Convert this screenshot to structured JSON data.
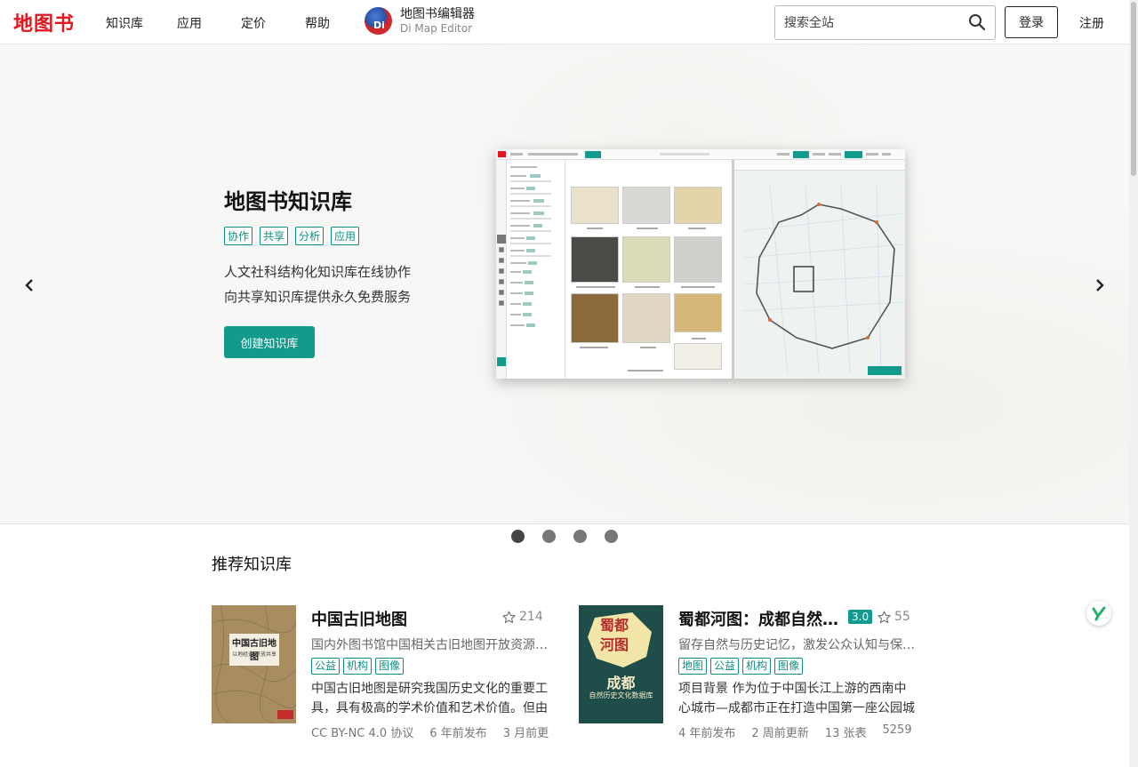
{
  "header": {
    "logo": "地图书",
    "nav": [
      "知识库",
      "应用",
      "定价",
      "帮助"
    ],
    "editor": {
      "badge": "Di",
      "title": "地图书编辑器",
      "subtitle": "Di Map Editor"
    },
    "search_placeholder": "搜索全站",
    "login_label": "登录",
    "register_label": "注册"
  },
  "hero": {
    "title": "地图书知识库",
    "tags": [
      "协作",
      "共享",
      "分析",
      "应用"
    ],
    "desc_line1": "人文社科结构化知识库在线协作",
    "desc_line2": "向共享知识库提供永久免费服务",
    "cta_label": "创建知识库",
    "slide_count": 4,
    "active_slide": 0
  },
  "recommended": {
    "title": "推荐知识库",
    "cards": [
      {
        "cover_title": "中国古旧地图",
        "cover_subtitle": "以地经史 开放共享",
        "title": "中国古旧地图",
        "stars": "214",
        "version": "",
        "subtitle": "国内外图书馆中国相关古旧地图开放资源汇总",
        "tags": [
          "公益",
          "机构",
          "图像"
        ],
        "desc": "中国古旧地图是研究我国历史文化的重要工具，具有极高的学术价值和艺术价值。但由于年代久远",
        "meta": [
          "CC BY-NC 4.0 协议",
          "6 年前发布",
          "3 月前更"
        ]
      },
      {
        "cover_title_1": "蜀都",
        "cover_title_2": "河图",
        "cover_city": "成都",
        "cover_db": "自然历史文化数据库",
        "title": "蜀都河图：成都自然历史文化数据库",
        "stars": "55",
        "version": "3.0",
        "subtitle": "留存自然与历史记忆，激发公众认知与保护意识",
        "tags": [
          "地图",
          "公益",
          "机构",
          "图像"
        ],
        "desc": "项目背景 作为位于中国长江上游的西南中心城市—成都市正在打造中国第一座公园城市",
        "meta": [
          "4 年前发布",
          "2 周前更新",
          "13 张表",
          "5259"
        ]
      }
    ]
  },
  "colors": {
    "brand": "#e4161d",
    "accent": "#129a8c"
  }
}
